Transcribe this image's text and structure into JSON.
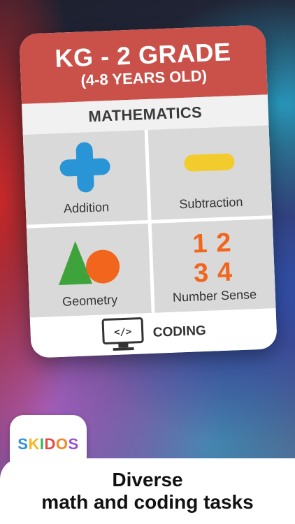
{
  "card": {
    "title": "KG - 2 GRADE",
    "subtitle": "(4-8 YEARS OLD)",
    "subject": "MATHEMATICS",
    "topics": [
      {
        "label": "Addition",
        "icon": "plus-icon"
      },
      {
        "label": "Subtraction",
        "icon": "minus-icon"
      },
      {
        "label": "Geometry",
        "icon": "shapes-icon"
      },
      {
        "label": "Number Sense",
        "icon": "numbers-icon"
      }
    ],
    "number_sense_digits": [
      "1",
      "2",
      "3",
      "4"
    ],
    "coding": {
      "label": "CODING",
      "icon": "code-monitor-icon"
    }
  },
  "logo": {
    "letters": [
      "S",
      "K",
      "I",
      "D",
      "O",
      "S"
    ],
    "letter_colors": [
      "#2f8fe0",
      "#f5b81c",
      "#35b553",
      "#e64848",
      "#f08a2a",
      "#9b4dd6"
    ]
  },
  "tagline": {
    "line1": "Diverse",
    "line2": "math and coding tasks"
  },
  "colors": {
    "header": "#c9514a",
    "plus": "#2a95d6",
    "minus": "#f2cc2c",
    "triangle": "#3da33a",
    "circle": "#f1651c",
    "digits": "#f1651c"
  }
}
